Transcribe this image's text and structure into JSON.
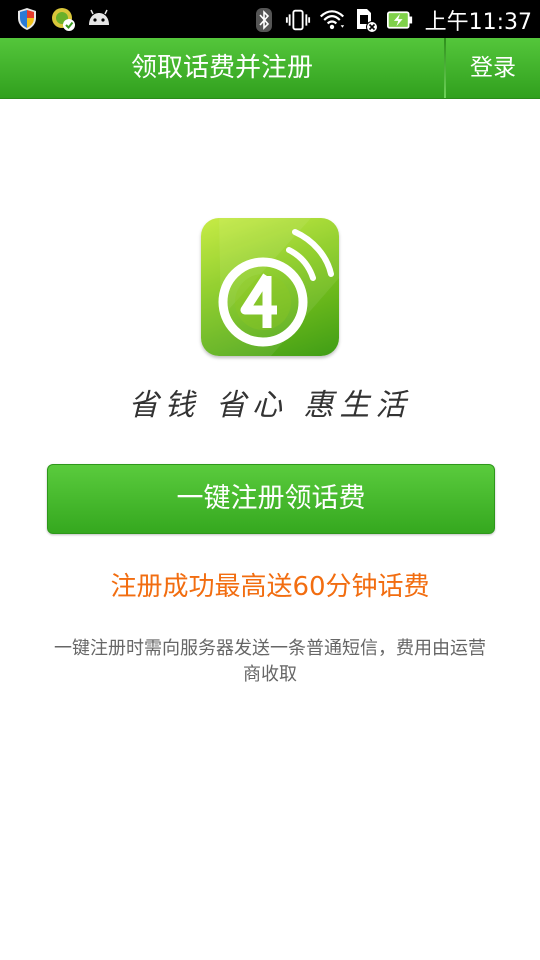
{
  "status_bar": {
    "time": "上午11:37",
    "left_icons": [
      "shield-icon",
      "app-notification-icon",
      "android-icon"
    ],
    "right_icons": [
      "bluetooth-icon",
      "vibrate-icon",
      "wifi-icon",
      "sim-card-icon",
      "battery-charging-icon"
    ]
  },
  "header": {
    "title": "领取话费并注册",
    "login_label": "登录",
    "accent_color": "#3cb12a"
  },
  "logo": {
    "icon": "4g-logo-icon",
    "slogan": "省钱 省心 惠生活"
  },
  "main": {
    "register_button_label": "一键注册领话费",
    "promo_text": "注册成功最高送60分钟话费",
    "promo_color": "#f26d10",
    "note_text": "一键注册时需向服务器发送一条普通短信，费用由运营商收取"
  }
}
